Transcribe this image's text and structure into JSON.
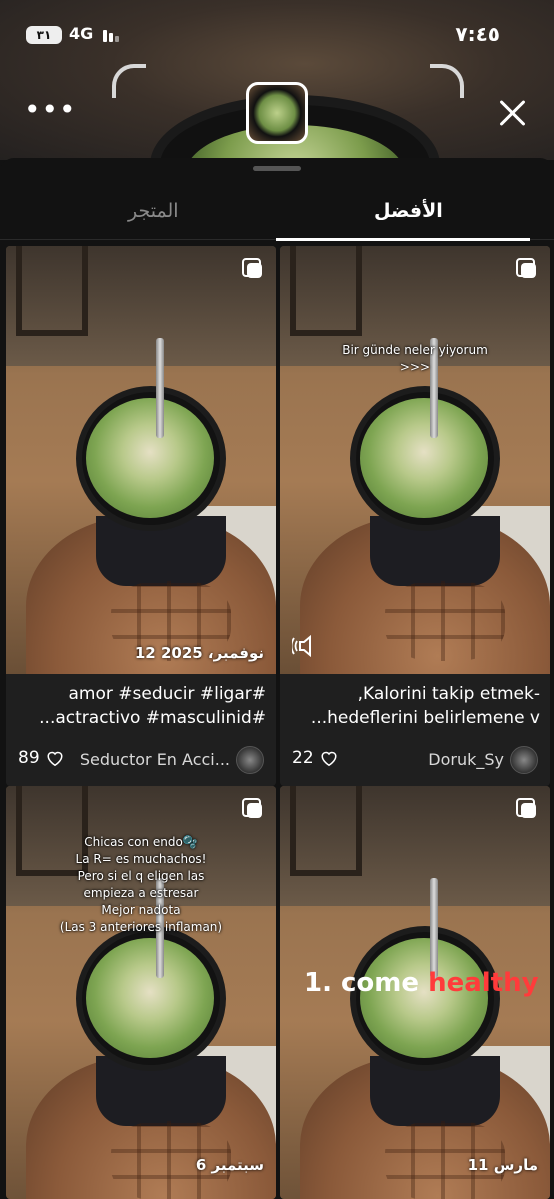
{
  "status_bar": {
    "time": "٧:٤٥",
    "battery": "٣١",
    "network": "4G"
  },
  "tabs": [
    {
      "label": "الأفضل",
      "active": true
    },
    {
      "label": "المتجر",
      "active": false
    }
  ],
  "cards": [
    {
      "overlay_text": "",
      "date": "12 نوفمبر، 2025",
      "caption_lines": [
        "#amor #seducir #ligar",
        "#actractivo #masculinid..."
      ],
      "likes": "89",
      "author": "Seductor En Acci..."
    },
    {
      "overlay_text": "Bir günde neler yiyorum\n>>>",
      "date": "",
      "caption_lines": [
        "-Kalorini takip etmek,",
        "hedeflerini belirlemene v..."
      ],
      "likes": "22",
      "author": "Doruk_Sy"
    },
    {
      "overlay_text": "Chicas con endo🫧\nLa R= es muchachos!\nPero si el q eligen las\nempieza a estresar\nMejor nadota\n(Las 3 anteriores inflaman)",
      "date": "6 سبتمبر"
    },
    {
      "overlay_caption": {
        "part1": "1. come ",
        "part2": "healthy"
      },
      "date": "11 مارس"
    }
  ],
  "icons": [
    "more-icon",
    "close-icon",
    "multi-image-icon",
    "heart-icon",
    "sound-icon"
  ],
  "colors": {
    "background": "#121212",
    "card": "#1f1f1f",
    "highlight_red": "#ff3b3b"
  }
}
